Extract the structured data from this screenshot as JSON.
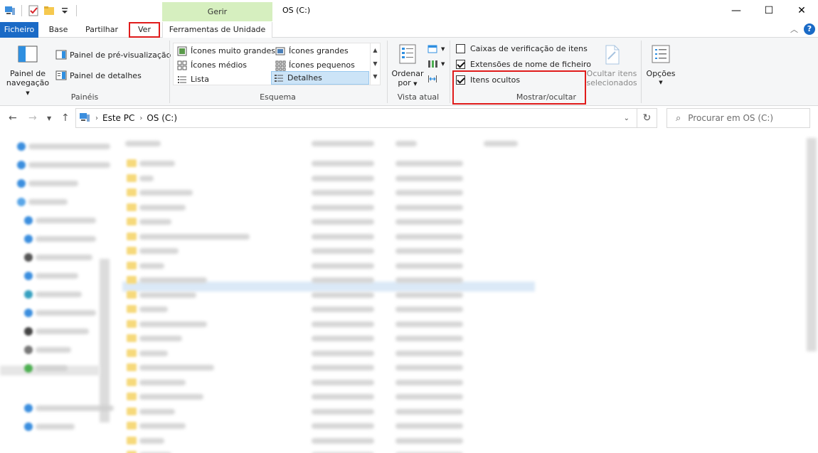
{
  "window": {
    "title": "OS (C:)",
    "context_tab_group": "Gerir",
    "controls": {
      "minimize": "—",
      "maximize": "☐",
      "close": "✕"
    }
  },
  "tabs": {
    "file": "Ficheiro",
    "base": "Base",
    "share": "Partilhar",
    "view": "Ver",
    "drive_tools": "Ferramentas de Unidade"
  },
  "ribbon": {
    "panes": {
      "nav_pane": "Painel de navegação",
      "nav_pane_l1": "Painel de",
      "nav_pane_l2": "navegação",
      "preview_pane": "Painel de pré-visualização",
      "details_pane": "Painel de detalhes",
      "label": "Painéis"
    },
    "layout": {
      "items": [
        "Ícones muito grandes",
        "Ícones grandes",
        "Ícones médios",
        "Ícones pequenos",
        "Lista",
        "Detalhes"
      ],
      "selected": "Detalhes",
      "label": "Esquema"
    },
    "current_view": {
      "sort_l1": "Ordenar",
      "sort_l2": "por",
      "label": "Vista atual"
    },
    "show_hide": {
      "item_checkboxes": "Caixas de verificação de itens",
      "item_checkboxes_checked": false,
      "file_extensions": "Extensões de nome de ficheiro",
      "file_extensions_checked": true,
      "hidden_items": "Itens ocultos",
      "hidden_items_checked": true,
      "hide_selected_l1": "Ocultar itens",
      "hide_selected_l2": "selecionados",
      "label": "Mostrar/ocultar"
    },
    "options": "Opções"
  },
  "address": {
    "crumbs": [
      "Este PC",
      "OS (C:)"
    ]
  },
  "search": {
    "placeholder": "Procurar em OS (C:)"
  },
  "colors": {
    "file_tab": "#1a6ac6",
    "context_tab": "#d6efbf",
    "highlight": "#e01b1b",
    "selected_layout": "#cce4f7"
  }
}
